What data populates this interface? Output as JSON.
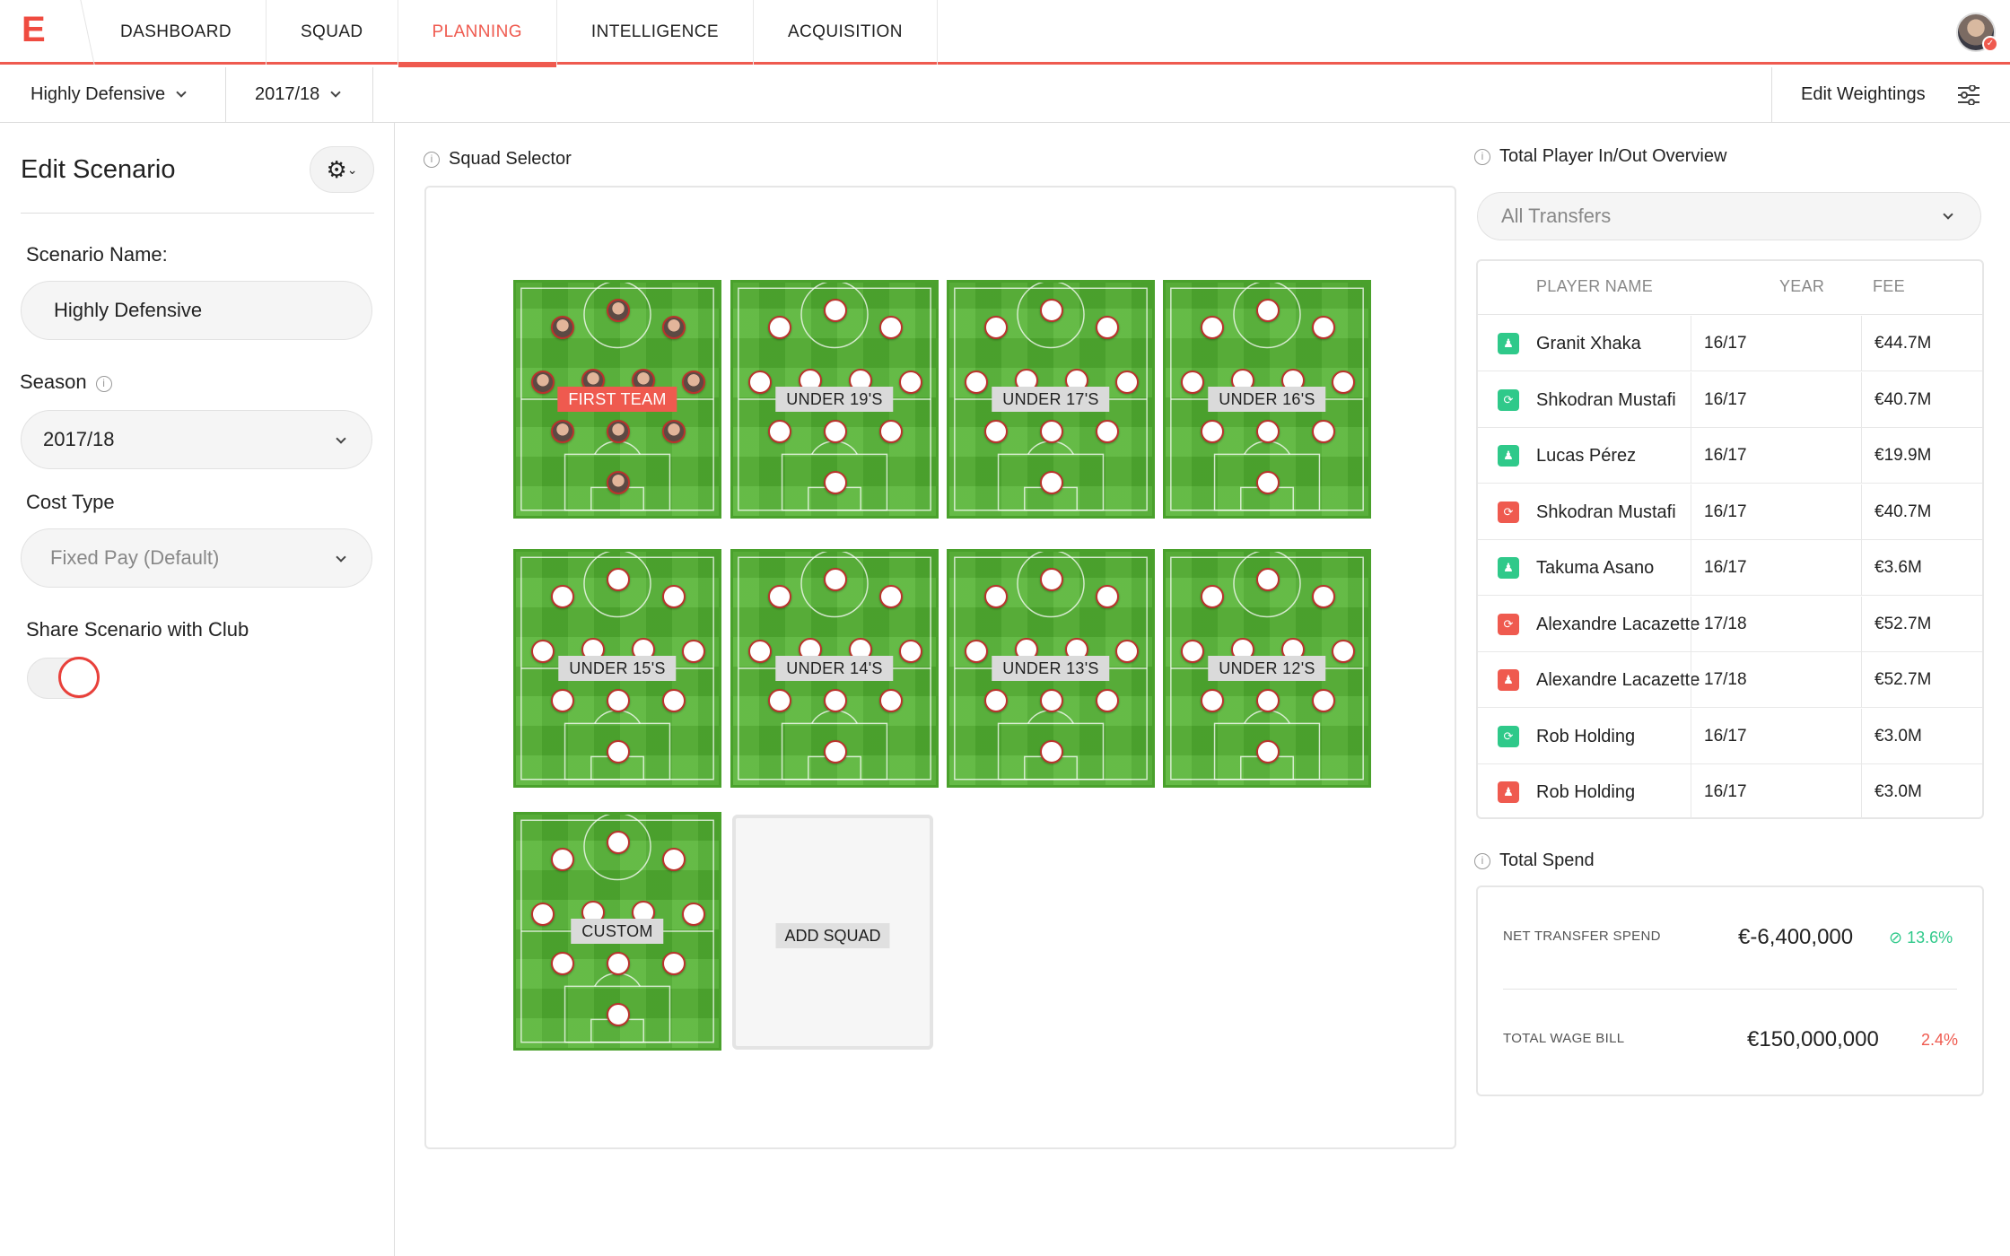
{
  "nav": {
    "logo": "E",
    "tabs": [
      {
        "label": "DASHBOARD"
      },
      {
        "label": "SQUAD"
      },
      {
        "label": "PLANNING"
      },
      {
        "label": "INTELLIGENCE"
      },
      {
        "label": "ACQUISITION"
      }
    ],
    "active_tab": "PLANNING"
  },
  "subbar": {
    "scenario": "Highly Defensive",
    "season": "2017/18",
    "edit_weightings": "Edit Weightings"
  },
  "edit_panel": {
    "title": "Edit Scenario",
    "scenario_name_label": "Scenario Name:",
    "scenario_name_value": "Highly Defensive",
    "season_label": "Season",
    "season_value": "2017/18",
    "cost_type_label": "Cost Type",
    "cost_type_value": "Fixed Pay (Default)",
    "share_label": "Share Scenario with Club",
    "share_enabled": false
  },
  "squad_selector": {
    "title": "Squad Selector",
    "squads": [
      {
        "label": "FIRST TEAM",
        "active": true
      },
      {
        "label": "UNDER 19'S",
        "active": false
      },
      {
        "label": "UNDER 17'S",
        "active": false
      },
      {
        "label": "UNDER 16'S",
        "active": false
      },
      {
        "label": "UNDER 15'S",
        "active": false
      },
      {
        "label": "UNDER 14'S",
        "active": false
      },
      {
        "label": "UNDER 13'S",
        "active": false
      },
      {
        "label": "UNDER 12'S",
        "active": false
      },
      {
        "label": "CUSTOM",
        "active": false
      }
    ],
    "add_label": "ADD SQUAD"
  },
  "overview": {
    "title": "Total Player In/Out Overview",
    "filter": "All Transfers",
    "columns": {
      "name": "PLAYER NAME",
      "year": "YEAR",
      "fee": "FEE"
    },
    "rows": [
      {
        "name": "Granit Xhaka",
        "year": "16/17",
        "fee": "€44.7M",
        "direction": "in",
        "kind": "player"
      },
      {
        "name": "Shkodran Mustafi",
        "year": "16/17",
        "fee": "€40.7M",
        "direction": "in",
        "kind": "loan"
      },
      {
        "name": "Lucas Pérez",
        "year": "16/17",
        "fee": "€19.9M",
        "direction": "in",
        "kind": "player"
      },
      {
        "name": "Shkodran Mustafi",
        "year": "16/17",
        "fee": "€40.7M",
        "direction": "out",
        "kind": "loan"
      },
      {
        "name": "Takuma Asano",
        "year": "16/17",
        "fee": "€3.6M",
        "direction": "in",
        "kind": "player"
      },
      {
        "name": "Alexandre Lacazette",
        "year": "17/18",
        "fee": "€52.7M",
        "direction": "out",
        "kind": "loan"
      },
      {
        "name": "Alexandre Lacazette",
        "year": "17/18",
        "fee": "€52.7M",
        "direction": "out",
        "kind": "player"
      },
      {
        "name": "Rob Holding",
        "year": "16/17",
        "fee": "€3.0M",
        "direction": "in",
        "kind": "loan"
      },
      {
        "name": "Rob Holding",
        "year": "16/17",
        "fee": "€3.0M",
        "direction": "out",
        "kind": "player"
      }
    ]
  },
  "spend": {
    "title": "Total Spend",
    "net_label": "NET TRANSFER SPEND",
    "net_value": "€-6,400,000",
    "net_pct": "13.6%",
    "wage_label": "TOTAL WAGE BILL",
    "wage_value": "€150,000,000",
    "wage_pct": "2.4%"
  },
  "colors": {
    "accent": "#ef5a4f",
    "in": "#2fc98a",
    "out": "#ef5a4f",
    "pitch": "#53b332"
  }
}
